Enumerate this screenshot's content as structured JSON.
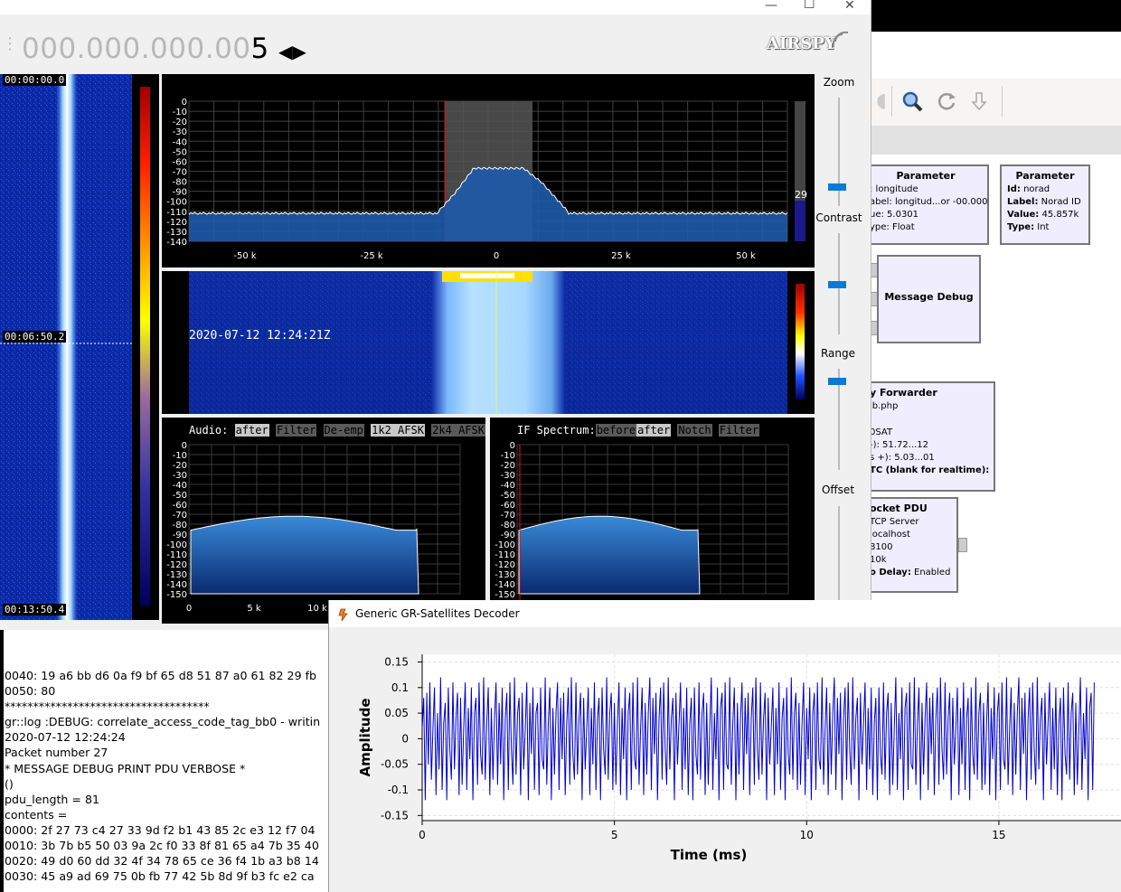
{
  "grc": {
    "blocks": [
      {
        "title": "Parameter",
        "lines": [
          [
            "",
            ": longitude"
          ],
          [
            "",
            "abel: longitud...or -00.000)"
          ],
          [
            "",
            "ue: 5.0301"
          ],
          [
            "",
            "ype: Float"
          ]
        ]
      },
      {
        "title": "Parameter",
        "lines": [
          [
            "Id:",
            " norad"
          ],
          [
            "Label:",
            " Norad ID"
          ],
          [
            "Value:",
            " 45.857k"
          ],
          [
            "Type:",
            " Int"
          ]
        ]
      },
      {
        "title": "Message Debug",
        "lines": []
      },
      {
        "title": "y Forwarder",
        "lines": [
          [
            "",
            "lb.php"
          ],
          [
            "",
            ""
          ],
          [
            "",
            "0SAT"
          ],
          [
            "",
            "-): 51.72...12"
          ],
          [
            "",
            "s +): 5.03...01"
          ],
          [
            "",
            "TC (blank for realtime):"
          ]
        ]
      },
      {
        "title": "ocket PDU",
        "lines": [
          [
            "",
            "TCP Server"
          ],
          [
            "",
            "localhost"
          ],
          [
            "",
            "8100"
          ],
          [
            "",
            "10k"
          ],
          [
            "o Delay:",
            " Enabled"
          ]
        ]
      }
    ],
    "toolbar_icons": [
      "search-icon",
      "refresh-icon",
      "arrow-icon"
    ]
  },
  "airspy": {
    "frequency_dim": "000.000.000.00",
    "frequency_last": "5",
    "logo": "AIRSPY",
    "waterfall_times": [
      "00:00:00.0",
      "00:06:50.2",
      "00:13:50.4"
    ],
    "fft_ylabels": [
      "0",
      "-10",
      "-20",
      "-30",
      "-40",
      "-50",
      "-60",
      "-70",
      "-80",
      "-90",
      "-100",
      "-110",
      "-120",
      "-130",
      "-140"
    ],
    "fft_xlabels": [
      "-50 k",
      "-25 k",
      "0",
      "25 k",
      "50 k"
    ],
    "fft_level": "29",
    "waterfall_timestamp": "2020-07-12 12:24:21Z",
    "sliders": [
      "Zoom",
      "Contrast",
      "Range",
      "Offset"
    ],
    "audio": {
      "label": "Audio:",
      "buttons": [
        "after",
        "Filter",
        "De-emp",
        "1k2 AFSK",
        "2k4 AFSK"
      ],
      "ylabels": [
        "0",
        "-10",
        "-20",
        "-30",
        "-40",
        "-50",
        "-60",
        "-70",
        "-80",
        "-90",
        "-100",
        "-110",
        "-120",
        "-130",
        "-140",
        "-150"
      ],
      "xlabels": [
        "0",
        "5 k",
        "10 k"
      ]
    },
    "if": {
      "label": "IF Spectrum:",
      "buttons": [
        "before",
        "after",
        "Notch",
        "Filter"
      ],
      "ylabels": [
        "0",
        "-10",
        "-20",
        "-30",
        "-40",
        "-50",
        "-60",
        "-70",
        "-80",
        "-90",
        "-100",
        "-110",
        "-120",
        "-130",
        "-140",
        "-150"
      ]
    }
  },
  "terminal": {
    "lines": [
      "0040: 19 a6 bb d6 0a f9 bf 65 d8 51 87 a0 61 82 29 fb",
      "0050: 80",
      "************************************",
      "gr::log :DEBUG: correlate_access_code_tag_bb0 - writin",
      "2020-07-12 12:24:24",
      "Packet number 27",
      "* MESSAGE DEBUG PRINT PDU VERBOSE *",
      "()",
      "pdu_length = 81",
      "contents =",
      "0000: 2f 27 73 c4 27 33 9d f2 b1 43 85 2c e3 12 f7 04",
      "0010: 3b 7b b5 50 03 9a 2c f0 33 8f 81 65 a4 7b 35 40",
      "0020: 49 d0 60 dd 32 4f 34 78 65 ce 36 f4 1b a3 b8 14",
      "0030: 45 a9 ad 69 75 0b fb 77 42 5b 8d 9f b3 fc e2 ca"
    ]
  },
  "decoder": {
    "title": "Generic GR-Satellites Decoder",
    "app_icon": "gnuradio-icon"
  },
  "chart_data": {
    "type": "line",
    "title": "",
    "xlabel": "Time (ms)",
    "ylabel": "Amplitude",
    "xlim": [
      0,
      18.2
    ],
    "ylim": [
      -0.16,
      0.165
    ],
    "xticks": [
      0,
      5,
      10,
      15
    ],
    "yticks": [
      0.15,
      0.1,
      0.05,
      0,
      -0.05,
      -0.1,
      -0.15
    ],
    "ytick_labels": [
      "0.15",
      "0.1",
      "0.05",
      "0",
      "-0.05",
      "-0.1",
      "-0.15"
    ],
    "xtick_labels": [
      "0",
      "5",
      "10",
      "15"
    ],
    "grid": true,
    "series": [
      {
        "color": "#0000cc",
        "sample_period_ms": 0.04,
        "description_note": "",
        "values": [
          0.02,
          0.08,
          -0.12,
          0.09,
          -0.05,
          0.11,
          -0.08,
          0.02,
          0.1,
          -0.11,
          0.05,
          -0.06,
          0.12,
          -0.1,
          0.03,
          0.07,
          -0.12,
          0.1,
          -0.02,
          -0.08,
          0.11,
          -0.06,
          0.04,
          0.09,
          -0.11,
          0.08,
          -0.09,
          0.02,
          0.11,
          -0.1,
          0.06,
          -0.04,
          0.1,
          -0.12,
          0.05,
          0.08,
          -0.09,
          0.11,
          -0.03,
          -0.07,
          0.12,
          -0.08,
          0.03,
          0.1,
          -0.11,
          0.06,
          -0.08,
          0.04,
          0.11,
          -0.09,
          0.07,
          -0.05,
          0.1,
          -0.12,
          0.04,
          0.09,
          -0.1,
          0.11,
          -0.02,
          -0.09,
          0.12,
          -0.07,
          0.05,
          0.08,
          -0.11,
          0.09,
          -0.06,
          0.02,
          0.11,
          -0.12,
          0.07,
          -0.03,
          0.1,
          -0.1,
          0.05,
          0.07,
          -0.11,
          0.1,
          -0.04,
          -0.06,
          0.12,
          -0.09,
          0.03,
          0.1,
          -0.12,
          0.06,
          -0.07,
          0.05,
          0.11,
          -0.1,
          0.08,
          -0.04,
          0.09,
          -0.11,
          0.03,
          0.1,
          -0.09,
          0.12,
          -0.03,
          -0.08,
          0.11,
          -0.07,
          0.04,
          0.09,
          -0.12,
          0.08,
          -0.06,
          0.02,
          0.1,
          -0.11,
          0.06,
          -0.05,
          0.11,
          -0.1,
          0.04,
          0.08,
          -0.12,
          0.1,
          -0.02,
          -0.07,
          0.12,
          -0.08,
          0.05,
          0.09,
          -0.1,
          0.07,
          -0.09,
          0.03,
          0.11,
          -0.11,
          0.06,
          -0.04,
          0.1,
          -0.12,
          0.05,
          0.09,
          -0.1,
          0.11,
          -0.04,
          -0.06,
          0.12,
          -0.09,
          0.02,
          0.1,
          -0.11,
          0.07,
          -0.07,
          0.05,
          0.12,
          -0.1,
          0.08,
          -0.03,
          0.09,
          -0.12,
          0.04,
          0.1,
          -0.08,
          0.11,
          -0.02,
          -0.09,
          0.12,
          -0.06,
          0.04,
          0.08,
          -0.12,
          0.09,
          -0.05,
          0.03,
          0.11,
          -0.1,
          0.06,
          -0.06,
          0.1,
          -0.11,
          0.03,
          0.08,
          -0.12,
          0.1,
          -0.03,
          -0.07,
          0.11,
          -0.08,
          0.05,
          0.09,
          -0.11,
          0.07,
          -0.09,
          0.02,
          0.12,
          -0.1,
          0.05,
          -0.04,
          0.1,
          -0.12,
          0.06,
          0.09,
          -0.1,
          0.11,
          -0.05,
          -0.06,
          0.12,
          -0.09,
          0.03,
          0.1,
          -0.12,
          0.07,
          -0.07,
          0.04,
          0.11,
          -0.1,
          0.08,
          -0.03,
          0.09,
          -0.11,
          0.04,
          0.1,
          -0.09,
          0.12,
          -0.02,
          -0.08,
          0.11,
          -0.07,
          0.04,
          0.09,
          -0.12,
          0.08,
          -0.05,
          0.02,
          0.1,
          -0.11,
          0.06,
          -0.05,
          0.11,
          -0.1,
          0.04,
          0.08,
          -0.12,
          0.1,
          -0.03,
          -0.07,
          0.12,
          -0.08,
          0.05,
          0.09,
          -0.1,
          0.07,
          -0.09,
          0.03,
          0.11,
          -0.11,
          0.06,
          -0.04,
          0.1,
          -0.12,
          0.05,
          0.09,
          -0.1,
          0.11,
          -0.04,
          -0.06,
          0.12,
          -0.09,
          0.02,
          0.1,
          -0.11,
          0.07,
          -0.07,
          0.05,
          0.12,
          -0.1,
          0.08,
          -0.03,
          0.09,
          -0.12,
          0.04,
          0.1,
          -0.08,
          0.11,
          -0.02,
          -0.09,
          0.12,
          -0.06,
          0.04,
          0.08,
          -0.12,
          0.09,
          -0.05,
          0.03,
          0.11,
          -0.1,
          0.06,
          -0.06,
          0.1,
          -0.11,
          0.03,
          0.08,
          -0.12,
          0.1,
          -0.03,
          -0.07,
          0.11,
          -0.08,
          0.05,
          0.09,
          -0.11,
          0.07,
          -0.09,
          0.02,
          0.12,
          -0.1,
          0.05,
          -0.04,
          0.1,
          -0.12,
          0.06,
          0.09,
          -0.1,
          0.11,
          -0.05,
          -0.06,
          0.12,
          -0.09,
          0.03,
          0.1,
          -0.12,
          0.07,
          -0.07,
          0.04,
          0.11,
          -0.1,
          0.08,
          -0.03,
          0.09,
          -0.11,
          0.04,
          0.1,
          -0.09,
          0.12,
          -0.02,
          -0.08,
          0.11,
          -0.07,
          0.04,
          0.09,
          -0.12,
          0.08,
          -0.05,
          0.02,
          0.1,
          -0.11,
          0.06,
          -0.05,
          0.11,
          -0.1,
          0.04,
          0.08,
          -0.12,
          0.1,
          -0.03,
          -0.07,
          0.12,
          -0.08,
          0.05,
          0.09,
          -0.1,
          0.07,
          -0.09,
          0.03,
          0.11,
          -0.11,
          0.06,
          -0.04,
          0.1,
          -0.12,
          0.05,
          0.09,
          -0.1,
          0.11,
          -0.04,
          -0.06,
          0.12,
          -0.09,
          0.02,
          0.1,
          -0.11,
          0.07,
          -0.07,
          0.05,
          0.12,
          -0.1,
          0.08,
          -0.03,
          0.09,
          -0.12,
          0.04,
          0.1,
          -0.08,
          0.11,
          -0.02,
          -0.09,
          0.12,
          -0.06,
          0.04,
          0.08,
          -0.12,
          0.09,
          -0.05,
          0.03,
          0.11,
          -0.1,
          0.06,
          -0.06,
          0.1,
          -0.11,
          0.03,
          0.08,
          -0.12,
          0.1,
          -0.03,
          -0.07,
          0.11,
          -0.08,
          0.05,
          0.09,
          -0.11,
          0.07,
          -0.09,
          0.02,
          0.12,
          -0.1,
          0.05,
          -0.04,
          0.1,
          -0.12,
          0.06,
          0.09,
          -0.1,
          0.11
        ]
      }
    ]
  }
}
